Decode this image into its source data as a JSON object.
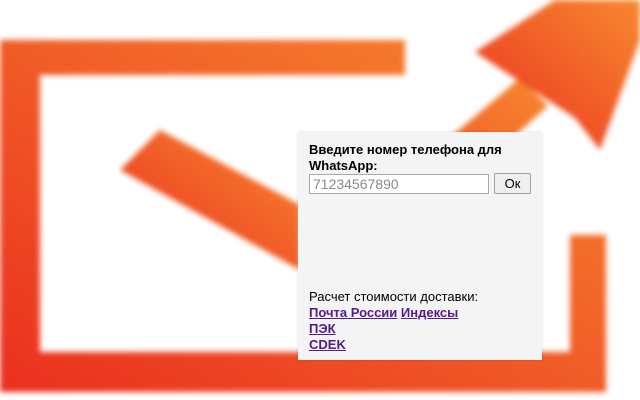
{
  "colors": {
    "logo_orange": "#f15a24",
    "logo_red": "#ea2f1f",
    "link": "#551a8b",
    "panel_bg": "#f4f4f4"
  },
  "background": {
    "logo_icon": "envelope-arrow-logo-icon"
  },
  "popup": {
    "phone_label": "Введите номер телефона для WhatsApp:",
    "phone_input": {
      "value": "",
      "placeholder": "71234567890"
    },
    "ok_label": "Ок",
    "delivery": {
      "heading": "Расчет стоимости доставки:",
      "links": {
        "pochta": "Почта России",
        "indexes": "Индексы",
        "pek": "ПЭК",
        "cdek": "CDEK"
      }
    }
  }
}
